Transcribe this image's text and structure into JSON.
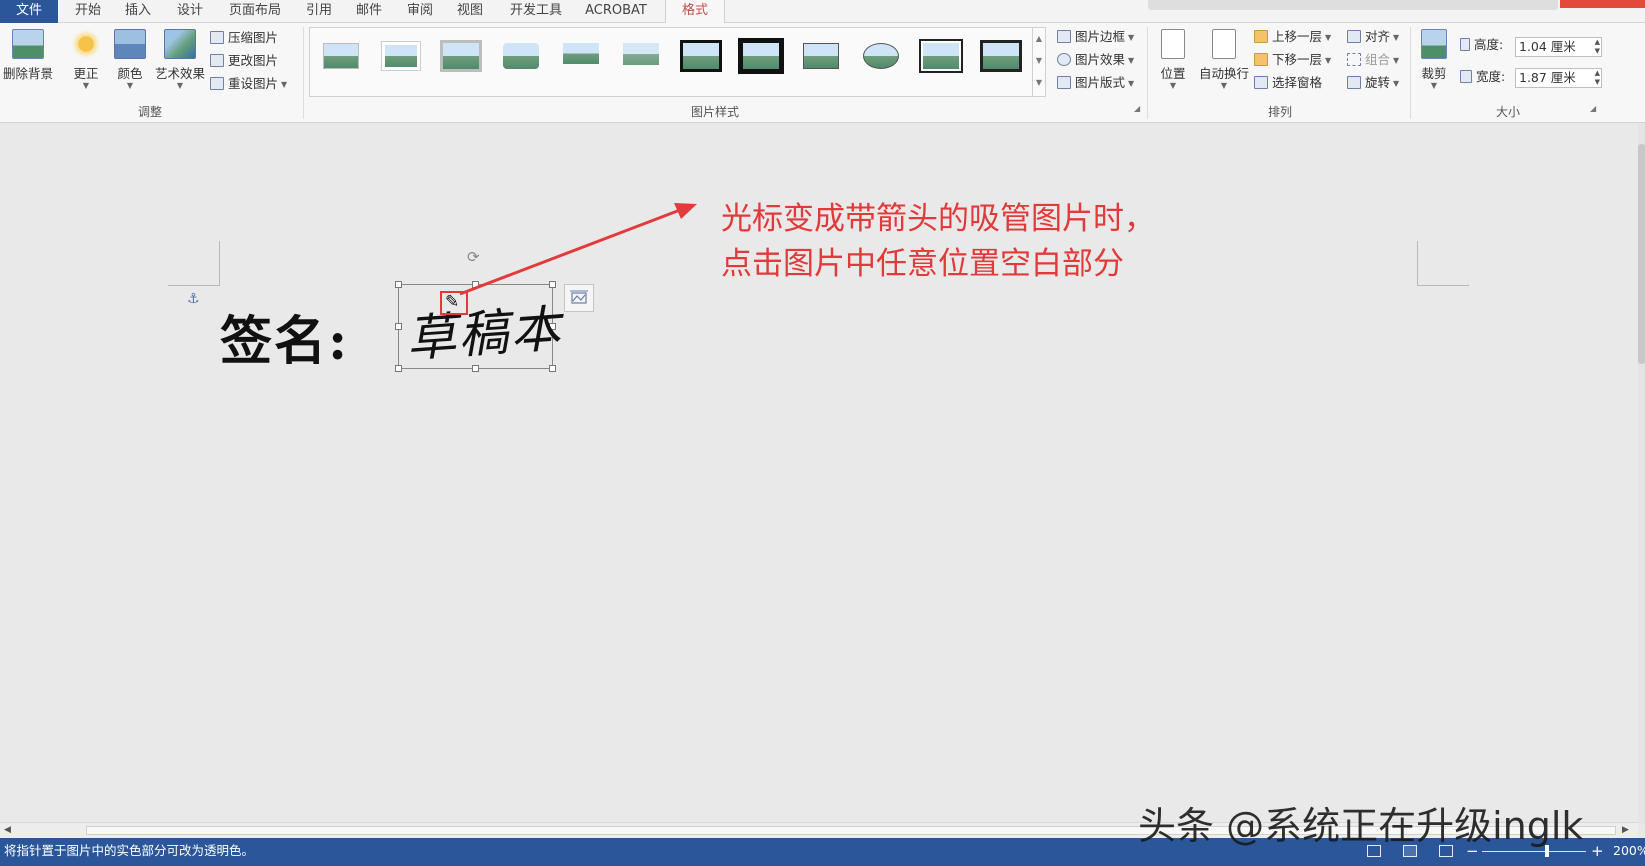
{
  "tabs": {
    "file": "文件",
    "home": "开始",
    "insert": "插入",
    "design": "设计",
    "layout": "页面布局",
    "references": "引用",
    "mailings": "邮件",
    "review": "审阅",
    "view": "视图",
    "developer": "开发工具",
    "acrobat": "ACROBAT",
    "format": "格式"
  },
  "ribbon": {
    "adjust": {
      "group_label": "调整",
      "remove_background": "删除背景",
      "corrections": "更正",
      "color": "颜色",
      "artistic_effects": "艺术效果",
      "compress_pictures": "压缩图片",
      "change_picture": "更改图片",
      "reset_picture": "重设图片"
    },
    "picture_styles": {
      "group_label": "图片样式",
      "picture_border": "图片边框",
      "picture_effects": "图片效果",
      "picture_layout": "图片版式"
    },
    "arrange": {
      "group_label": "排列",
      "position": "位置",
      "wrap_text": "自动换行",
      "bring_forward": "上移一层",
      "send_backward": "下移一层",
      "selection_pane": "选择窗格",
      "align": "对齐",
      "group": "组合",
      "rotate": "旋转"
    },
    "size": {
      "group_label": "大小",
      "crop": "裁剪",
      "height_label": "高度:",
      "height_value": "1.04 厘米",
      "width_label": "宽度:",
      "width_value": "1.87 厘米"
    }
  },
  "document": {
    "sign_label": "签名:",
    "signature_text": "草稿本",
    "annotation_line1": "光标变成带箭头的吸管图片时，",
    "annotation_line2": "点击图片中任意位置空白部分"
  },
  "statusbar": {
    "message": "将指针置于图片中的实色部分可改为透明色。",
    "zoom_level": "200%",
    "zoom_minus": "−",
    "zoom_plus": "+"
  },
  "watermark": "头条 @系统正在升级inglk",
  "colors": {
    "accent_blue": "#2b579a",
    "annotation_red": "#e23a3a",
    "format_tab_text": "#c0504d"
  }
}
